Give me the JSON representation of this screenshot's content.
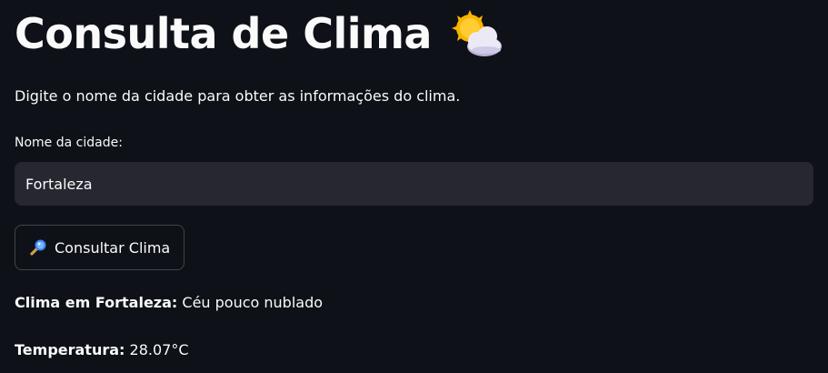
{
  "header": {
    "title": "Consulta de Clima",
    "title_icon": "sun-behind-cloud-icon"
  },
  "form": {
    "instructions": "Digite o nome da cidade para obter as informações do clima.",
    "city_label": "Nome da cidade:",
    "city_value": "Fortaleza",
    "submit_label": "Consultar Clima",
    "submit_icon": "magnifying-glass-icon"
  },
  "result": {
    "condition_label": "Clima em Fortaleza:",
    "condition_value": "Céu pouco nublado",
    "temperature_label": "Temperatura:",
    "temperature_value": "28.07°C"
  },
  "colors": {
    "background": "#0e1117",
    "input_background": "#262730",
    "text": "#fafafa"
  }
}
